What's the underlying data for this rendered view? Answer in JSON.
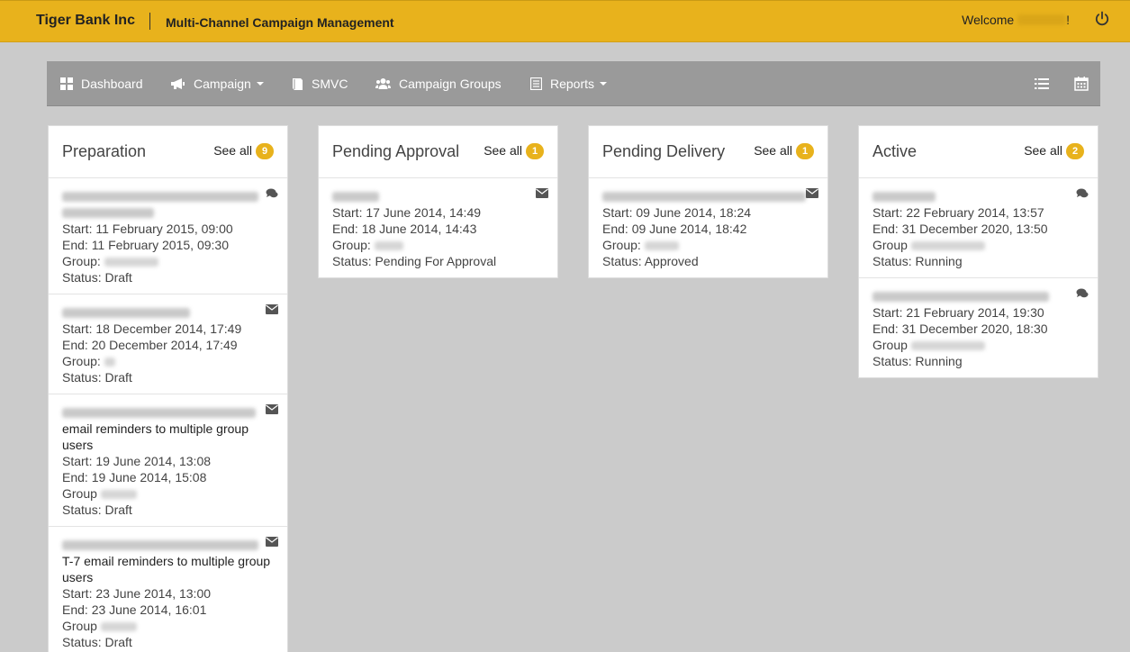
{
  "header": {
    "brand": "Tiger Bank Inc",
    "app_title": "Multi-Channel Campaign Management",
    "welcome": "Welcome",
    "welcome_suffix": "!"
  },
  "nav": {
    "dashboard": "Dashboard",
    "campaign": "Campaign",
    "smvc": "SMVC",
    "campaign_groups": "Campaign Groups",
    "reports": "Reports"
  },
  "columns": [
    {
      "title": "Preparation",
      "see_all": "See all",
      "count": "9",
      "cards": [
        {
          "icon": "comment-icon",
          "desc": "",
          "start": "Start: 11 February 2015, 09:00",
          "end": "End: 11 February 2015, 09:30",
          "group": "Group:",
          "status": "Status: Draft"
        },
        {
          "icon": "envelope-icon",
          "desc": "",
          "start": "Start: 18 December 2014, 17:49",
          "end": "End: 20 December 2014, 17:49",
          "group": "Group:",
          "status": "Status: Draft"
        },
        {
          "icon": "envelope-icon",
          "desc": "email reminders to multiple group users",
          "start": "Start: 19 June 2014, 13:08",
          "end": "End: 19 June 2014, 15:08",
          "group": "Group",
          "status": "Status: Draft"
        },
        {
          "icon": "envelope-icon",
          "desc": "T-7 email reminders to multiple group users",
          "start": "Start: 23 June 2014, 13:00",
          "end": "End: 23 June 2014, 16:01",
          "group": "Group",
          "status": "Status: Draft"
        }
      ]
    },
    {
      "title": "Pending Approval",
      "see_all": "See all",
      "count": "1",
      "cards": [
        {
          "icon": "envelope-icon",
          "desc": "",
          "start": "Start: 17 June 2014, 14:49",
          "end": "End: 18 June 2014, 14:43",
          "group": "Group:",
          "status": "Status: Pending For Approval"
        }
      ]
    },
    {
      "title": "Pending Delivery",
      "see_all": "See all",
      "count": "1",
      "cards": [
        {
          "icon": "envelope-icon",
          "desc": "",
          "start": "Start: 09 June 2014, 18:24",
          "end": "End: 09 June 2014, 18:42",
          "group": "Group:",
          "status": "Status: Approved"
        }
      ]
    },
    {
      "title": "Active",
      "see_all": "See all",
      "count": "2",
      "cards": [
        {
          "icon": "comment-icon",
          "desc": "",
          "start": "Start: 22 February 2014, 13:57",
          "end": "End: 31 December 2020, 13:50",
          "group": "Group",
          "status": "Status: Running"
        },
        {
          "icon": "comment-icon",
          "desc": "",
          "start": "Start: 21 February 2014, 19:30",
          "end": "End: 31 December 2020, 18:30",
          "group": "Group",
          "status": "Status: Running"
        }
      ]
    }
  ]
}
